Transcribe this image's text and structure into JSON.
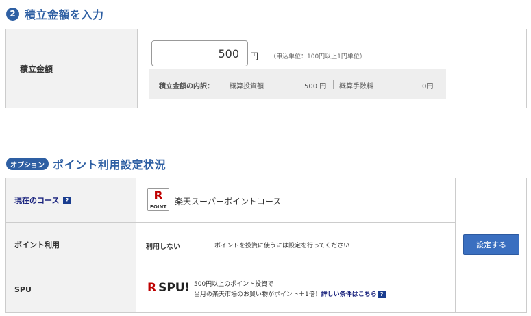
{
  "section1": {
    "step_number": "2",
    "title": "積立金額を入力",
    "row_label": "積立金額",
    "amount_value": "500",
    "yen": "円",
    "unit_note": "（申込単位：100円以上1円単位）",
    "breakdown": {
      "label": "積立金額の内訳：",
      "invest_label": "概算投資額",
      "invest_value": "500 円",
      "fee_label": "概算手数料",
      "fee_value": "0円"
    }
  },
  "section2": {
    "badge": "オプション",
    "title": "ポイント利用設定状況",
    "course_label": "現在のコース",
    "course_help": "?",
    "course_name": "楽天スーパーポイントコース",
    "logo_letter": "R",
    "logo_text": "POINT",
    "point_use_label": "ポイント利用",
    "point_use_status": "利用しない",
    "point_use_note": "ポイントを投資に使うには設定を行ってください",
    "spu_label": "SPU",
    "spu_logo_r": "R",
    "spu_logo_text": "SPU!",
    "spu_line1": "500円以上のポイント投資で",
    "spu_line2": "当月の楽天市場のお買い物がポイント＋1倍！",
    "spu_link": "詳しい条件はこちら",
    "spu_help": "?",
    "settings_button": "設定する"
  },
  "colors": {
    "accent": "#2e5fa3",
    "button": "#3a6fc0",
    "rakuten_red": "#bf0000",
    "link": "#1a237e"
  }
}
